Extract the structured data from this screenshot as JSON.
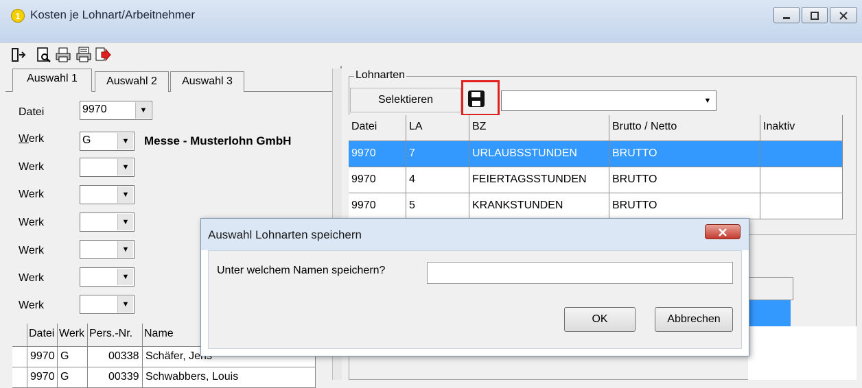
{
  "window": {
    "badge": "1",
    "title": "Kosten je Lohnart/Arbeitnehmer"
  },
  "toolbar": {
    "icons": [
      "exit-icon",
      "preview-icon",
      "print-icon",
      "print-list-icon",
      "export-icon"
    ]
  },
  "left": {
    "tabs": [
      "Auswahl 1",
      "Auswahl 2",
      "Auswahl 3"
    ],
    "datei_label": "Datei",
    "datei_value": "9970",
    "werk_first_label_prefix": "W",
    "werk_first_label_rest": "erk",
    "werk_first_value": "G",
    "company": "Messe - Musterlohn GmbH",
    "werk_labels": [
      "Werk",
      "Werk",
      "Werk",
      "Werk",
      "Werk",
      "Werk",
      "Werk"
    ],
    "table": {
      "headers": [
        "Datei",
        "Werk",
        "Pers.-Nr.",
        "Name"
      ],
      "rows": [
        [
          "9970",
          "G",
          "00338",
          "Schäfer, Jens"
        ],
        [
          "9970",
          "G",
          "00339",
          "Schwabbers, Louis"
        ]
      ]
    }
  },
  "right": {
    "group_title": "Lohnarten",
    "select_button": "Selektieren",
    "save_icon": "floppy-disk-icon",
    "highlight_color": "#e0201c",
    "table": {
      "headers": [
        "Datei",
        "LA",
        "BZ",
        "Brutto / Netto",
        "Inaktiv"
      ],
      "rows": [
        [
          "9970",
          "7",
          "URLAUBSSTUNDEN",
          "BRUTTO",
          ""
        ],
        [
          "9970",
          "4",
          "FEIERTAGSSTUNDEN",
          "BRUTTO",
          ""
        ],
        [
          "9970",
          "5",
          "KRANKSTUNDEN",
          "BRUTTO",
          ""
        ]
      ],
      "selected_color": "#3399ff"
    }
  },
  "dialog": {
    "title": "Auswahl Lohnarten speichern",
    "prompt": "Unter welchem Namen speichern?",
    "input_value": "",
    "ok": "OK",
    "cancel": "Abbrechen",
    "close_color": "#c9463d"
  }
}
